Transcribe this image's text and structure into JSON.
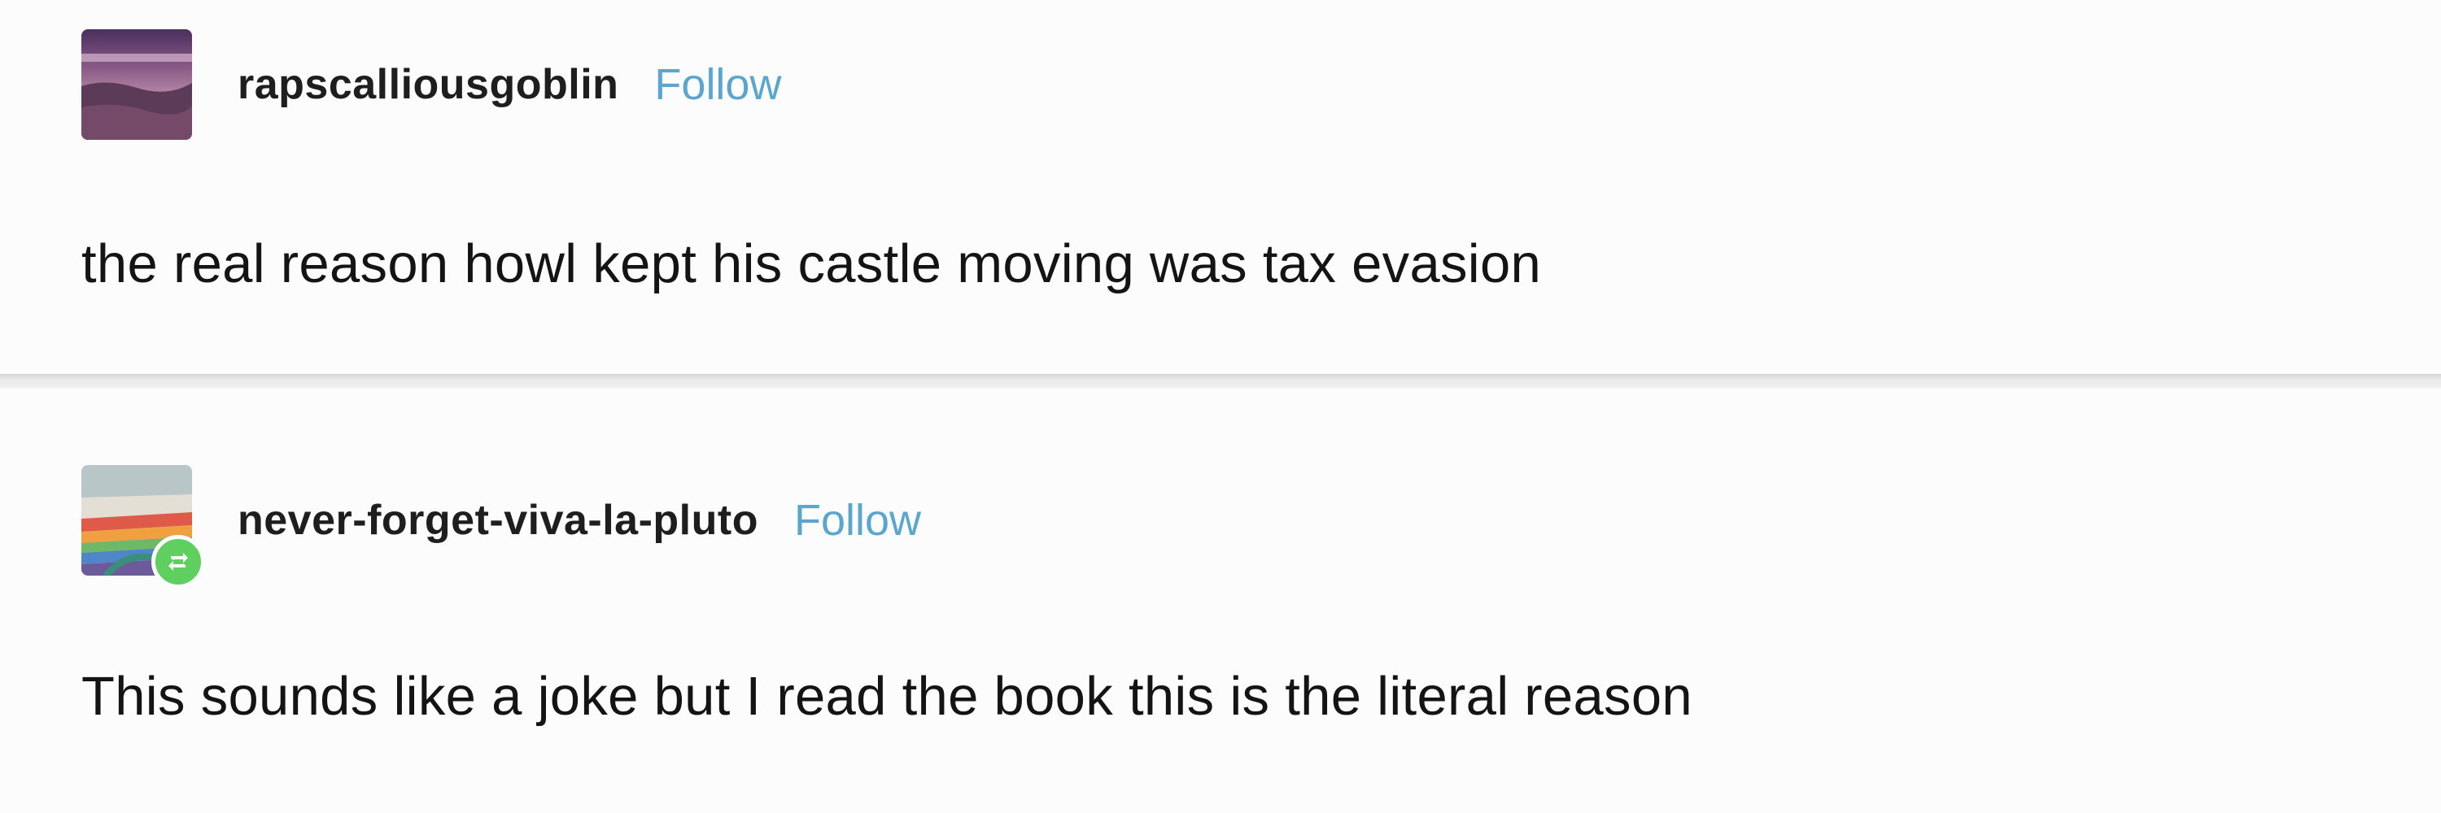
{
  "posts": [
    {
      "username": "rapscalliousgoblin",
      "follow_label": "Follow",
      "text": "the real reason howl kept his castle moving was tax evasion",
      "avatar_icon": "landscape-avatar"
    },
    {
      "username": "never-forget-viva-la-pluto",
      "follow_label": "Follow",
      "text": "This sounds like a joke but I read the book this is the literal reason",
      "avatar_icon": "rainbow-landscape-avatar",
      "badge_icon": "reblog-icon"
    }
  ],
  "colors": {
    "follow": "#5aa6cf",
    "reblog_badge": "#5fcf5f",
    "divider": "#d6d6d6"
  }
}
